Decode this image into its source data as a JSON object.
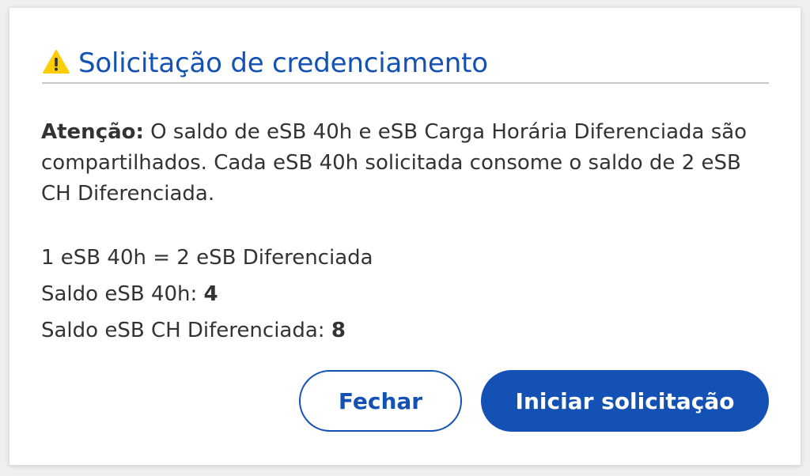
{
  "dialog": {
    "title": "Solicitação de credenciamento",
    "icon": "warning-icon",
    "colors": {
      "primary": "#1351b4",
      "warning": "#ffcd07",
      "text": "#333333"
    }
  },
  "content": {
    "attention_label": "Atenção:",
    "attention_text": " O saldo de eSB 40h e eSB Carga Horária Diferenciada são compartilhados. Cada eSB 40h solicitada consome o saldo de 2 eSB CH Diferenciada.",
    "equivalence": "1 eSB 40h = 2 eSB Diferenciada",
    "saldo_40h_label": "Saldo eSB 40h: ",
    "saldo_40h_value": "4",
    "saldo_ch_label": "Saldo eSB CH Diferenciada: ",
    "saldo_ch_value": "8"
  },
  "actions": {
    "close_label": "Fechar",
    "start_label": "Iniciar solicitação"
  }
}
